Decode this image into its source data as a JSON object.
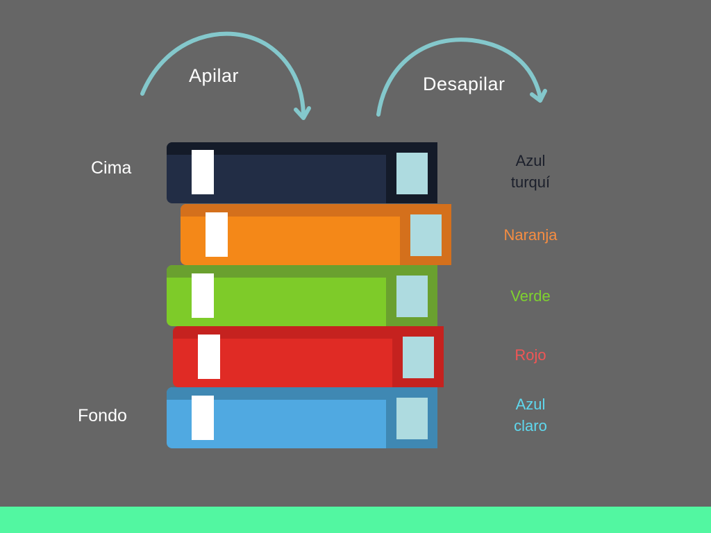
{
  "operations": {
    "push_label": "Apilar",
    "pop_label": "Desapilar"
  },
  "stack_labels": {
    "top": "Cima",
    "bottom": "Fondo"
  },
  "books": [
    {
      "name": "Azul\nturquí",
      "label_color": "#1b1f2b",
      "cover_color": "#222d45",
      "dark_color": "#141b29"
    },
    {
      "name": "Naranja",
      "label_color": "#f68d42",
      "cover_color": "#f48818",
      "dark_color": "#d4701c"
    },
    {
      "name": "Verde",
      "label_color": "#7fd22f",
      "cover_color": "#7ecb29",
      "dark_color": "#6aa02f"
    },
    {
      "name": "Rojo",
      "label_color": "#f05656",
      "cover_color": "#e02b25",
      "dark_color": "#c5221f"
    },
    {
      "name": "Azul\nclaro",
      "label_color": "#5fd8ee",
      "cover_color": "#50a9e1",
      "dark_color": "#3f88b3"
    }
  ],
  "colors": {
    "background": "#666666",
    "arrow": "#84c8cc",
    "page_edge": "#aedbe0",
    "footer": "#52f7a1"
  }
}
